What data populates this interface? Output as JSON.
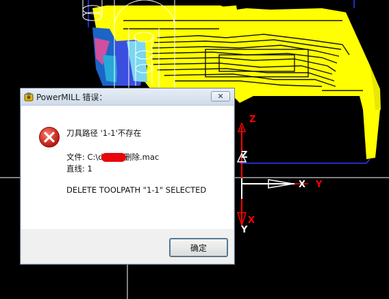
{
  "dialog": {
    "title": "PowerMILL 错误：",
    "close_symbol": "✕",
    "message_line1": "刀具路径 '1-1'不存在",
    "file_prefix": "文件: C:\\dcam",
    "file_suffix": "删除.mac",
    "line_label": "直线: 1",
    "command": "DELETE TOOLPATH \"1-1\" SELECTED",
    "ok_label": "确定"
  },
  "viewport": {
    "axis_labels": {
      "z_upper": "Z",
      "z_lower": "Z",
      "x_right": "X",
      "y_right": "Y",
      "x_lower": "X",
      "y_lower": "Y"
    },
    "colors": {
      "background": "#000000",
      "model": "#ffff00",
      "wire": "#ffffff",
      "blue_wire": "#2c3cff",
      "axis_red": "#ff0000",
      "axis_white": "#ffffff"
    }
  }
}
